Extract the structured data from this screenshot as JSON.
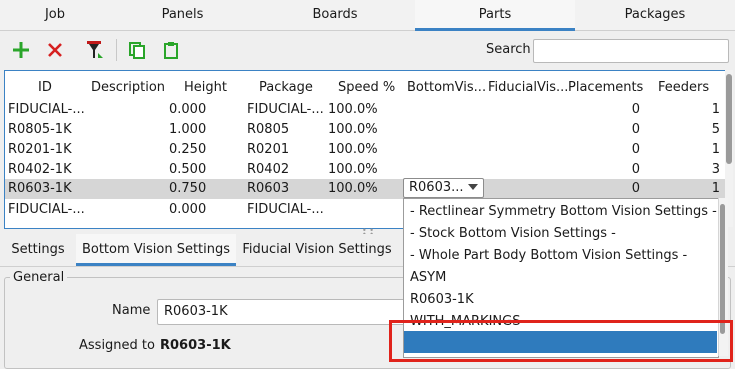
{
  "tabs": [
    "Job",
    "Panels",
    "Boards",
    "Parts",
    "Packages"
  ],
  "active_tab": "Parts",
  "toolbar": {
    "add_icon": "plus-icon",
    "delete_icon": "x-icon",
    "filter_icon": "funnel-icon",
    "copy_icon": "copy-icon",
    "paste_icon": "paste-icon",
    "search_label": "Search",
    "search_value": ""
  },
  "table": {
    "columns": [
      "ID",
      "Description",
      "Height",
      "Package",
      "Speed %",
      "BottomVis...",
      "FiducialVis...",
      "Placements",
      "Feeders"
    ],
    "rows": [
      {
        "id": "FIDUCIAL-...",
        "desc": "",
        "height": "0.000",
        "package": "FIDUCIAL-...",
        "speed": "100.0%",
        "bv": "",
        "fv": "",
        "placements": "0",
        "feeders": "1"
      },
      {
        "id": "R0805-1K",
        "desc": "",
        "height": "1.000",
        "package": "R0805",
        "speed": "100.0%",
        "bv": "",
        "fv": "",
        "placements": "0",
        "feeders": "5"
      },
      {
        "id": "R0201-1K",
        "desc": "",
        "height": "0.250",
        "package": "R0201",
        "speed": "100.0%",
        "bv": "",
        "fv": "",
        "placements": "0",
        "feeders": "1"
      },
      {
        "id": "R0402-1K",
        "desc": "",
        "height": "0.500",
        "package": "R0402",
        "speed": "100.0%",
        "bv": "",
        "fv": "",
        "placements": "0",
        "feeders": "3"
      },
      {
        "id": "R0603-1K",
        "desc": "",
        "height": "0.750",
        "package": "R0603",
        "speed": "100.0%",
        "bv": "R0603...",
        "fv": "",
        "placements": "0",
        "feeders": "1"
      },
      {
        "id": "FIDUCIAL-...",
        "desc": "",
        "height": "0.000",
        "package": "FIDUCIAL-...",
        "speed": "",
        "bv": "",
        "fv": "",
        "placements": "",
        "feeders": ""
      }
    ]
  },
  "combo_value": "R0603...",
  "dropdown_options": [
    "- Rectlinear Symmetry Bottom Vision Settings -",
    "- Stock Bottom Vision Settings -",
    "- Whole Part Body Bottom Vision Settings -",
    "ASYM",
    "R0603-1K",
    "WITH_MARKINGS"
  ],
  "lower_tabs": [
    "Settings",
    "Bottom Vision Settings",
    "Fiducial Vision Settings"
  ],
  "active_lower_tab": "Bottom Vision Settings",
  "general": {
    "title": "General",
    "name_label": "Name",
    "name_value": "R0603-1K",
    "assigned_label": "Assigned to",
    "assigned_value": "R0603-1K"
  },
  "colors": {
    "accent": "#3b82c4",
    "highlight": "#2f7bbd",
    "annotation": "#e0231b",
    "add": "#2aa52a",
    "delete": "#d62020"
  }
}
